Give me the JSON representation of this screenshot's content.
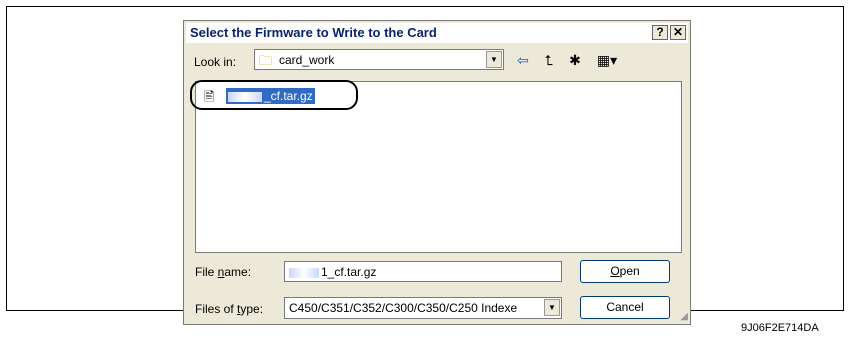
{
  "dialog": {
    "title": "Select the Firmware to Write to the Card",
    "help_label": "?",
    "close_label": "✕"
  },
  "lookin": {
    "label": "Look in:",
    "value": "card_work",
    "folder_icon": "folder-icon"
  },
  "toolbar": {
    "back_icon": "back-arrow-icon",
    "up_icon": "up-folder-icon",
    "new_icon": "new-folder-icon",
    "views_icon": "views-menu-icon"
  },
  "files": [
    {
      "name": "_cf.tar.gz",
      "selected": true,
      "icon": "file-icon"
    }
  ],
  "filename": {
    "label_pre": "File ",
    "label_u": "n",
    "label_post": "ame:",
    "value": "1_cf.tar.gz"
  },
  "filetype": {
    "label_pre": "Files of ",
    "label_u": "t",
    "label_post": "ype:",
    "value": "C450/C351/C352/C300/C350/C250 Indexe"
  },
  "buttons": {
    "open_u": "O",
    "open_rest": "pen",
    "cancel": "Cancel"
  },
  "figure_code": "9J06F2E714DA",
  "colors": {
    "title_text": "#0a246a",
    "selection": "#316ac5",
    "dialog_bg": "#ece9d8"
  }
}
